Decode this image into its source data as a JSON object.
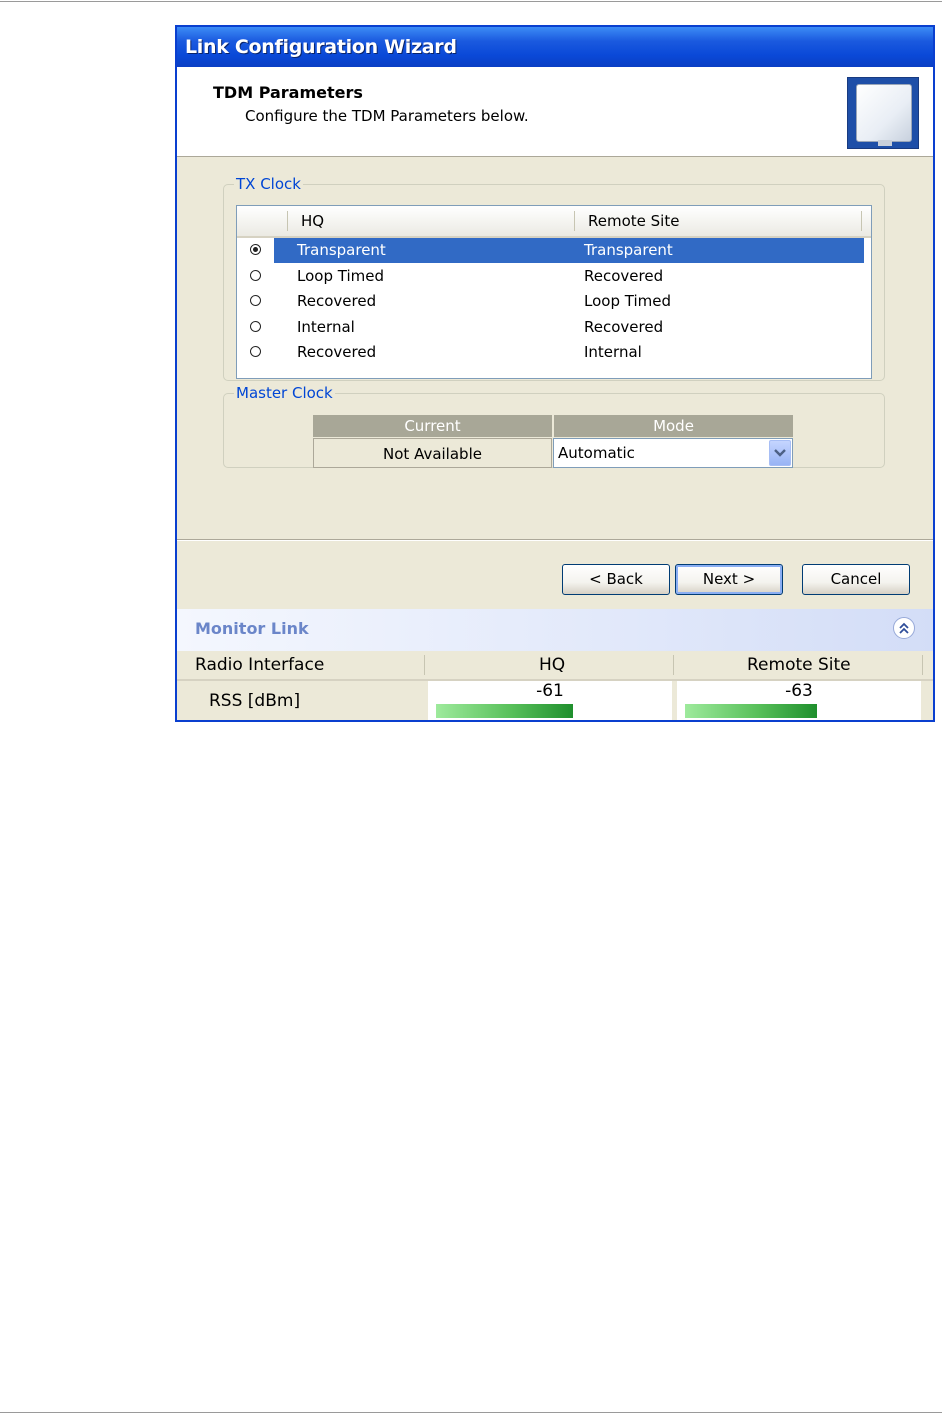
{
  "window": {
    "title": "Link Configuration Wizard"
  },
  "header": {
    "title": "TDM Parameters",
    "subtitle": "Configure the TDM Parameters below."
  },
  "tx_clock": {
    "legend": "TX Clock",
    "columns": {
      "hq": "HQ",
      "remote": "Remote Site"
    },
    "rows": [
      {
        "hq": "Transparent",
        "remote": "Transparent",
        "selected": true
      },
      {
        "hq": "Loop Timed",
        "remote": "Recovered",
        "selected": false
      },
      {
        "hq": "Recovered",
        "remote": "Loop Timed",
        "selected": false
      },
      {
        "hq": "Internal",
        "remote": "Recovered",
        "selected": false
      },
      {
        "hq": "Recovered",
        "remote": "Internal",
        "selected": false
      }
    ]
  },
  "master_clock": {
    "legend": "Master Clock",
    "current_header": "Current",
    "mode_header": "Mode",
    "current_value": "Not Available",
    "mode_value": "Automatic"
  },
  "buttons": {
    "back": "< Back",
    "next": "Next >",
    "cancel": "Cancel"
  },
  "monitor": {
    "title": "Monitor Link",
    "columns": {
      "interface": "Radio Interface",
      "hq": "HQ",
      "remote": "Remote Site"
    },
    "rss": {
      "label": "RSS [dBm]",
      "hq": "-61",
      "remote": "-63",
      "hq_level": 0.6,
      "remote_level": 0.58
    }
  },
  "colors": {
    "title_bar": "#0A49D8",
    "selection": "#316AC5",
    "legend": "#0046D5",
    "monitor_title": "#6B86C9"
  }
}
